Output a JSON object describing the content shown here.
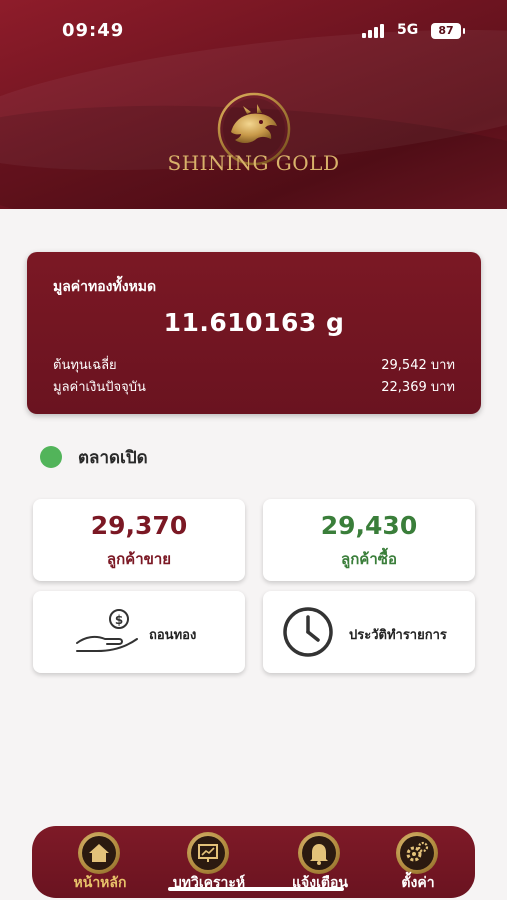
{
  "status_bar": {
    "time": "09:49",
    "network": "5G",
    "battery": "87"
  },
  "header": {
    "brand": "SHINING GOLD",
    "logo_icon": "dragon-logo-icon"
  },
  "summary": {
    "title": "มูลค่าทองทั้งหมด",
    "amount": "11.610163 g",
    "rows": [
      {
        "label": "ต้นทุนเฉลี่ย",
        "value": "29,542 บาท"
      },
      {
        "label": "มูลค่าเงินปัจจุบัน",
        "value": "22,369 บาท"
      }
    ]
  },
  "market": {
    "label": "ตลาดเปิด",
    "status_color": "#52b45a"
  },
  "prices": {
    "sell": {
      "value": "29,370",
      "label": "ลูกค้าขาย",
      "color": "#7b1824"
    },
    "buy": {
      "value": "29,430",
      "label": "ลูกค้าซื้อ",
      "color": "#3a7e3a"
    }
  },
  "actions": [
    {
      "label": "ถอนทอง",
      "icon": "hand-coin-icon"
    },
    {
      "label": "ประวัติทำรายการ",
      "icon": "clock-icon"
    }
  ],
  "nav": [
    {
      "label": "หน้าหลัก",
      "icon": "home-icon",
      "active": true
    },
    {
      "label": "บทวิเคราะห์",
      "icon": "analysis-icon",
      "active": false
    },
    {
      "label": "แจ้งเตือน",
      "icon": "bell-icon",
      "active": false
    },
    {
      "label": "ตั้งค่า",
      "icon": "gear-icon",
      "active": false
    }
  ],
  "colors": {
    "brand": "#7b1824",
    "gold": "#d8b26a",
    "active_tab": "#e8c26a"
  }
}
